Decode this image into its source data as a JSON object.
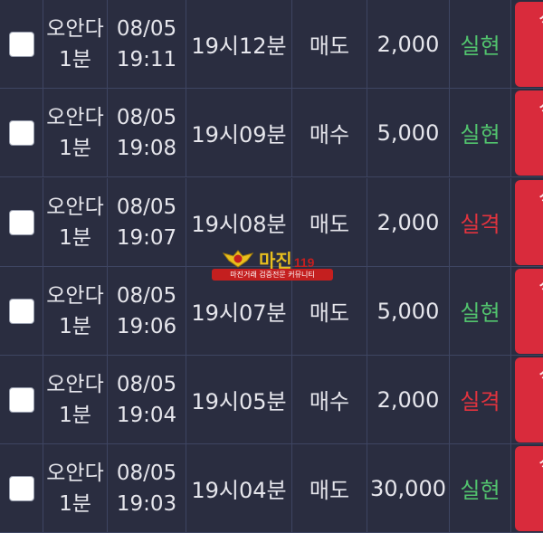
{
  "rows": [
    {
      "name": "오안다",
      "period": "1분",
      "date": "08/05",
      "time": "19:11",
      "round": "19시12분",
      "type": "매도",
      "amount": "2,000",
      "result": "실현",
      "result_kind": "win",
      "button": "삭제"
    },
    {
      "name": "오안다",
      "period": "1분",
      "date": "08/05",
      "time": "19:08",
      "round": "19시09분",
      "type": "매수",
      "amount": "5,000",
      "result": "실현",
      "result_kind": "win",
      "button": "삭제"
    },
    {
      "name": "오안다",
      "period": "1분",
      "date": "08/05",
      "time": "19:07",
      "round": "19시08분",
      "type": "매도",
      "amount": "2,000",
      "result": "실격",
      "result_kind": "lose",
      "button": "삭제"
    },
    {
      "name": "오안다",
      "period": "1분",
      "date": "08/05",
      "time": "19:06",
      "round": "19시07분",
      "type": "매도",
      "amount": "5,000",
      "result": "실현",
      "result_kind": "win",
      "button": "삭제"
    },
    {
      "name": "오안다",
      "period": "1분",
      "date": "08/05",
      "time": "19:04",
      "round": "19시05분",
      "type": "매수",
      "amount": "2,000",
      "result": "실격",
      "result_kind": "lose",
      "button": "삭제"
    },
    {
      "name": "오안다",
      "period": "1분",
      "date": "08/05",
      "time": "19:03",
      "round": "19시04분",
      "type": "매도",
      "amount": "30,000",
      "result": "실현",
      "result_kind": "win",
      "button": "삭제"
    }
  ],
  "watermark": {
    "title": "마진",
    "suffix": "119",
    "subtitle": "마진거래 검증전문 커뮤니티"
  },
  "colors": {
    "win": "#52c46e",
    "lose": "#e2333e",
    "button": "#d92b3c",
    "background": "#2a2d3f"
  }
}
